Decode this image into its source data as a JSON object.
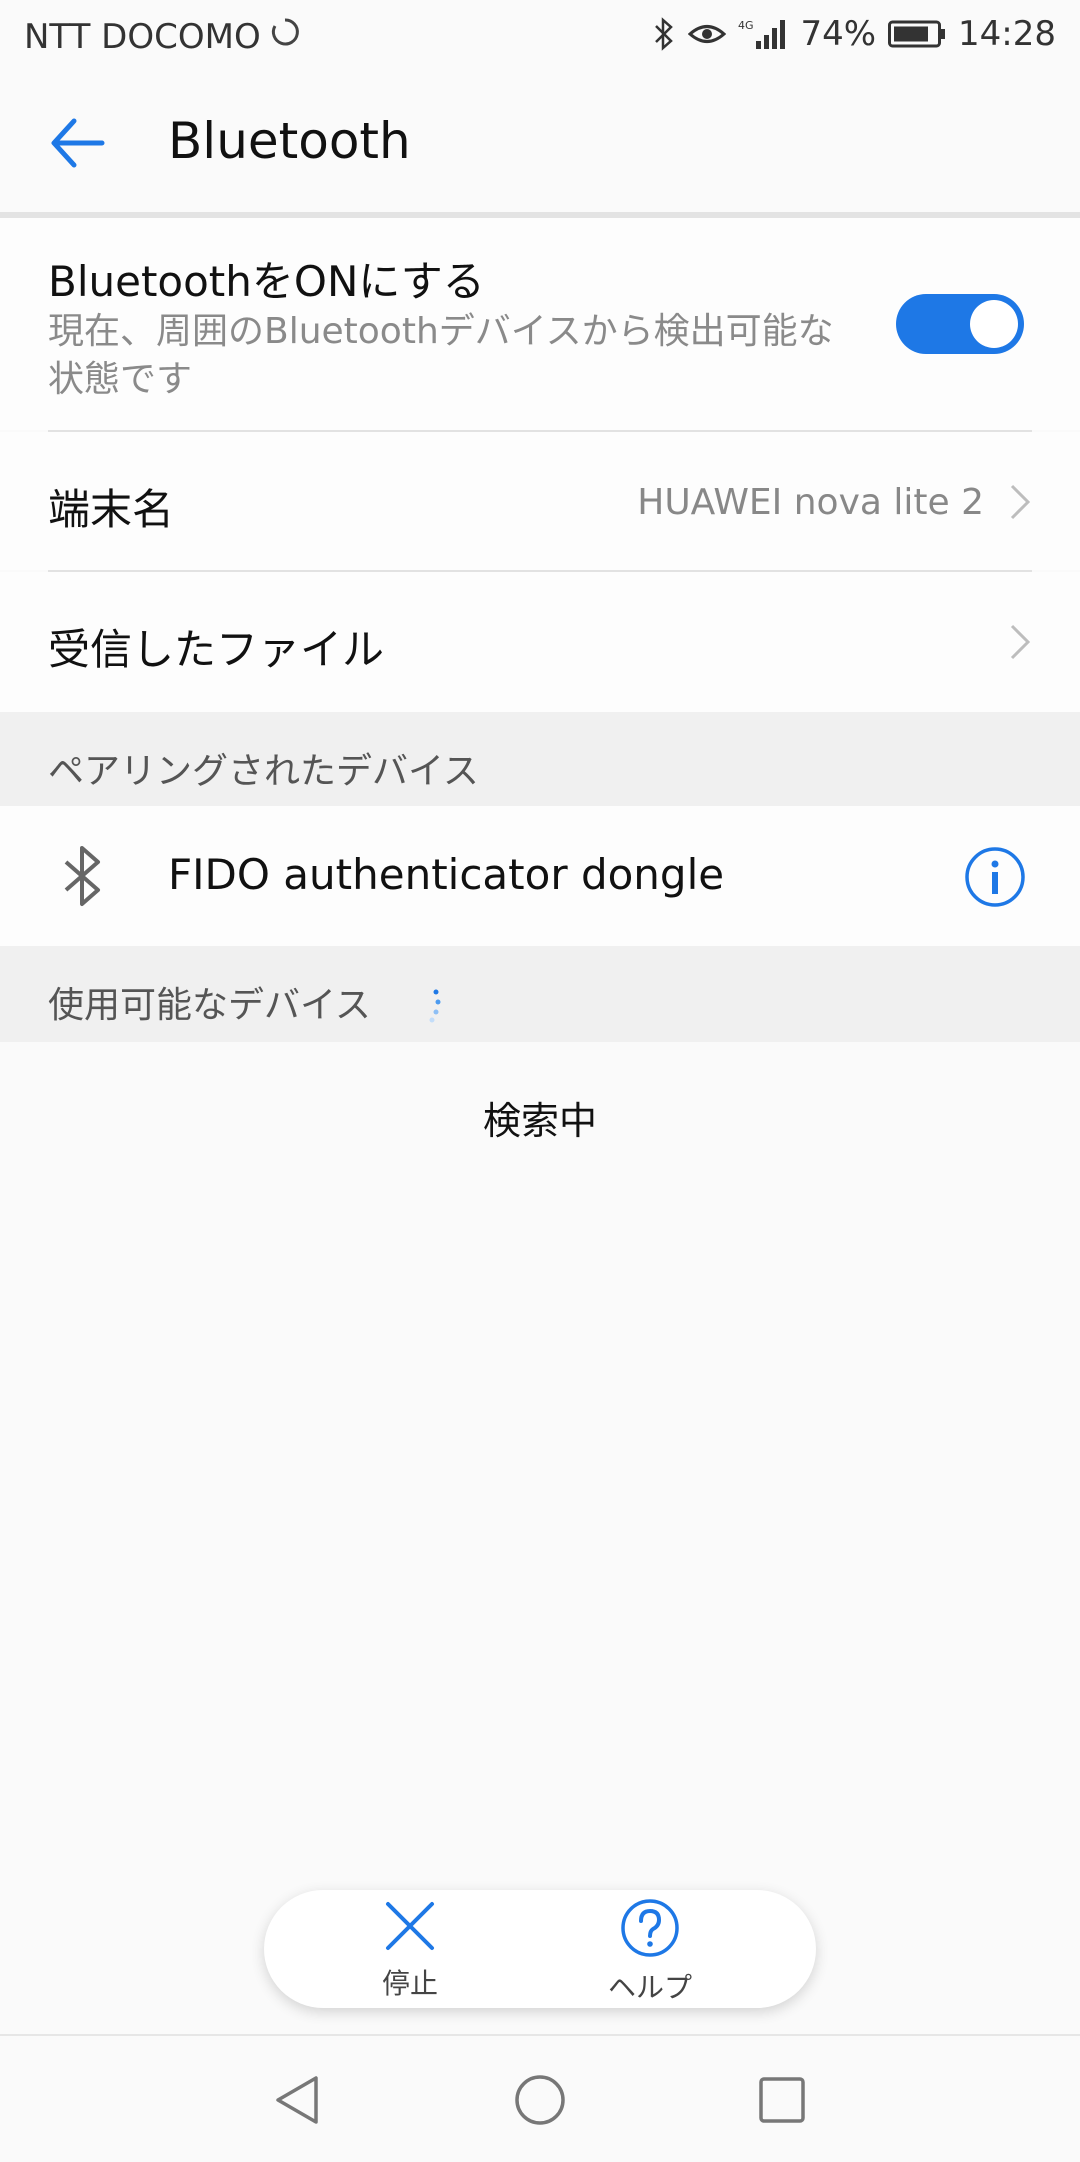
{
  "status_bar": {
    "carrier": "NTT DOCOMO",
    "network_label": "4G",
    "battery": "74%",
    "time": "14:28"
  },
  "appbar": {
    "title": "Bluetooth"
  },
  "bluetooth_toggle": {
    "title": "BluetoothをONにする",
    "subtitle": "現在、周囲のBluetoothデバイスから検出可能な状態です",
    "enabled": true,
    "accent_color": "#1e78e6"
  },
  "device_name": {
    "label": "端末名",
    "value": "HUAWEI nova lite 2"
  },
  "received_files": {
    "label": "受信したファイル"
  },
  "paired_section": {
    "header": "ペアリングされたデバイス",
    "devices": [
      {
        "name": "FIDO authenticator dongle",
        "icon": "bluetooth-icon"
      }
    ]
  },
  "available_section": {
    "header": "使用可能なデバイス",
    "status": "検索中"
  },
  "bottom_actions": {
    "stop_label": "停止",
    "help_label": "ヘルプ"
  }
}
